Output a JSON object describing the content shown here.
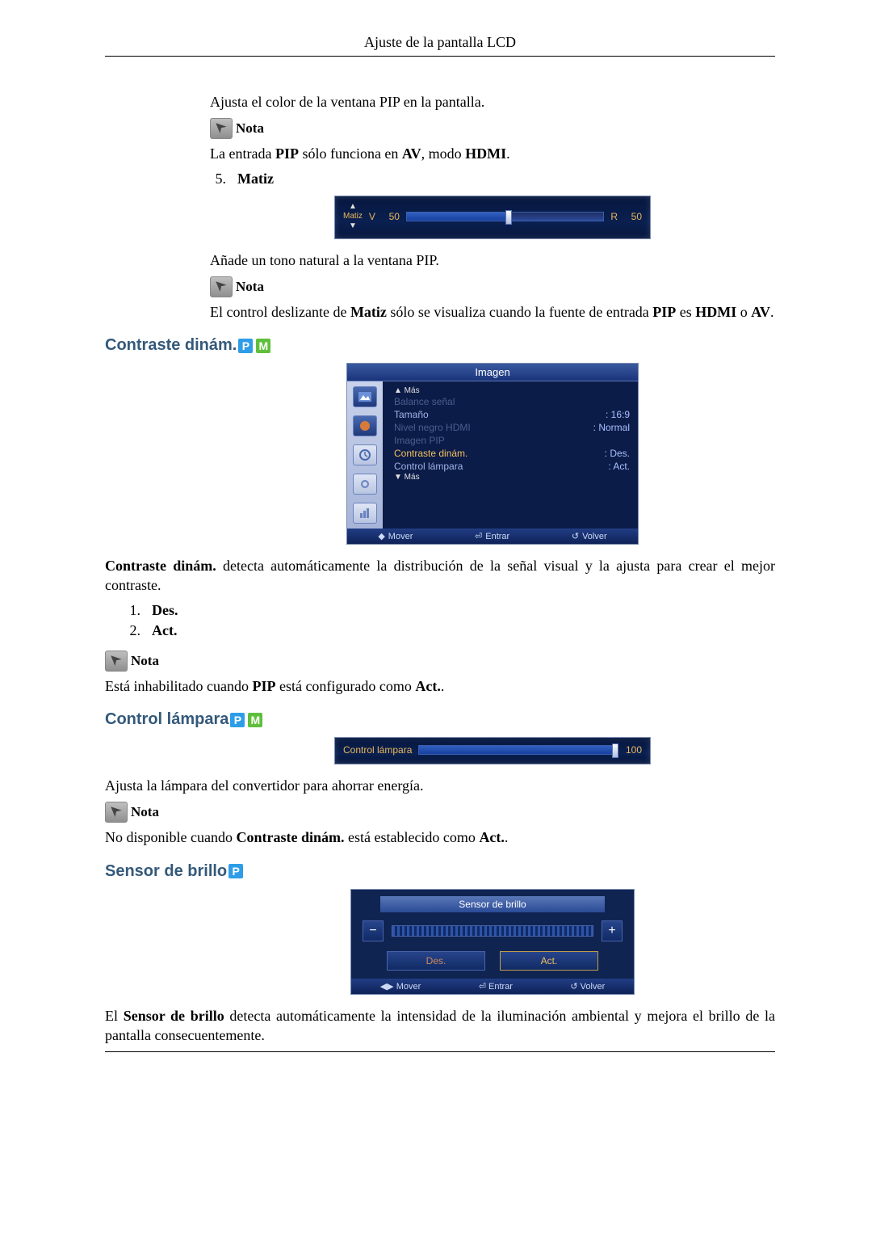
{
  "header": {
    "title": "Ajuste de la pantalla LCD"
  },
  "pip_color": {
    "desc": "Ajusta el color de la ventana PIP en la pantalla.",
    "note_label": "Nota",
    "note_text_pre": "La entrada ",
    "note_text_bold1": "PIP",
    "note_text_mid": " sólo funciona en ",
    "note_text_bold2": "AV",
    "note_text_mid2": ", modo ",
    "note_text_bold3": "HDMI",
    "note_text_end": "."
  },
  "matiz": {
    "num": "5.",
    "heading": "Matiz",
    "slider": {
      "label": "Matiz",
      "left_letter": "V",
      "left_val": "50",
      "right_letter": "R",
      "right_val": "50",
      "percent": 50
    },
    "desc": "Añade un tono natural a la ventana PIP.",
    "note_label": "Nota",
    "note_pre": "El control deslizante de ",
    "note_b1": "Matiz",
    "note_mid": " sólo se visualiza cuando la fuente de entrada ",
    "note_b2": "PIP",
    "note_mid2": " es ",
    "note_b3": "HDMI",
    "note_mid3": " o ",
    "note_b4": "AV",
    "note_end": "."
  },
  "contraste": {
    "heading": "Contraste dinám.",
    "badge_p": "P",
    "badge_m": "M",
    "menu": {
      "title": "Imagen",
      "up": "▲ Más",
      "items": [
        {
          "label": "Balance señal",
          "value": "",
          "cls": "disabled"
        },
        {
          "label": "Tamaño",
          "value": "16:9",
          "cls": ""
        },
        {
          "label": "Nivel negro HDMI",
          "value": "Normal",
          "cls": "disabled"
        },
        {
          "label": "Imagen PIP",
          "value": "",
          "cls": "disabled"
        },
        {
          "label": "Contraste dinám.",
          "value": "Des.",
          "cls": "active",
          "hl": true
        },
        {
          "label": "Control lámpara",
          "value": "Act.",
          "cls": "",
          "hl": true
        }
      ],
      "down": "▼ Más",
      "footer": {
        "move": "Mover",
        "enter": "Entrar",
        "back": "Volver"
      }
    },
    "desc_b": "Contraste dinám.",
    "desc_rest": " detecta automáticamente la distribución de la señal visual y la ajusta para crear el mejor contraste.",
    "opt1_num": "1.",
    "opt1": "Des.",
    "opt2_num": "2.",
    "opt2": "Act.",
    "note_label": "Nota",
    "note_pre": "Está inhabilitado cuando ",
    "note_b1": "PIP",
    "note_mid": " está configurado como ",
    "note_b2": "Act.",
    "note_end": "."
  },
  "lampara": {
    "heading": "Control lámpara",
    "badge_p": "P",
    "badge_m": "M",
    "slider": {
      "label": "Control lámpara",
      "value": "100",
      "percent": 100
    },
    "desc": "Ajusta la lámpara del convertidor para ahorrar energía.",
    "note_label": "Nota",
    "note_pre": "No disponible cuando ",
    "note_b1": "Contraste dinám.",
    "note_mid": " está establecido como ",
    "note_b2": "Act.",
    "note_end": "."
  },
  "sensor": {
    "heading": "Sensor de brillo",
    "badge_p": "P",
    "panel": {
      "title": "Sensor de brillo",
      "minus": "−",
      "plus": "+",
      "off": "Des.",
      "on": "Act.",
      "footer": {
        "move": "Mover",
        "enter": "Entrar",
        "back": "Volver"
      }
    },
    "desc_pre": "El ",
    "desc_b": "Sensor de brillo",
    "desc_rest": " detecta automáticamente la intensidad de la iluminación ambiental y mejora el brillo de la pantalla consecuentemente."
  }
}
